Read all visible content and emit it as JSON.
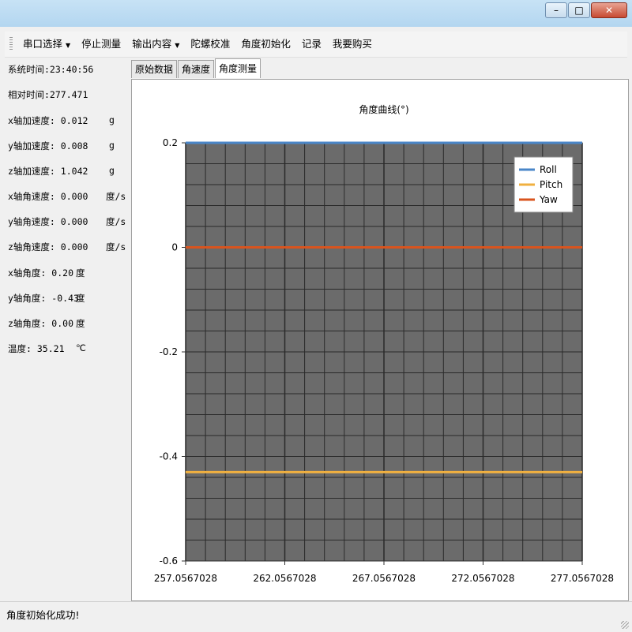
{
  "menu": {
    "items": [
      {
        "label": "串口选择",
        "dropdown": true
      },
      {
        "label": "停止测量",
        "dropdown": false
      },
      {
        "label": "输出内容",
        "dropdown": true
      },
      {
        "label": "陀螺校准",
        "dropdown": false
      },
      {
        "label": "角度初始化",
        "dropdown": false
      },
      {
        "label": "记录",
        "dropdown": false
      },
      {
        "label": "我要购买",
        "dropdown": false
      }
    ]
  },
  "window_buttons": {
    "minimize": "–",
    "maximize": "□",
    "close": "✕"
  },
  "info": {
    "system_time": "系统时间:23:40:56",
    "relative_time": "相对时间:277.471",
    "rows": [
      {
        "label": "x轴加速度:",
        "value": "0.012",
        "unit": "g"
      },
      {
        "label": "y轴加速度:",
        "value": "0.008",
        "unit": "g"
      },
      {
        "label": "z轴加速度:",
        "value": "1.042",
        "unit": "g"
      },
      {
        "label": "x轴角速度:",
        "value": "0.000",
        "unit": "度/s"
      },
      {
        "label": "y轴角速度:",
        "value": "0.000",
        "unit": "度/s"
      },
      {
        "label": "z轴角速度:",
        "value": "0.000",
        "unit": "度/s"
      },
      {
        "label": "x轴角度:",
        "value": "0.20",
        "unit": "度"
      },
      {
        "label": "y轴角度:",
        "value": "-0.43",
        "unit": "度"
      },
      {
        "label": "z轴角度:",
        "value": "0.00",
        "unit": "度"
      },
      {
        "label": "温度:",
        "value": "35.21",
        "unit": "℃"
      }
    ]
  },
  "tabs": [
    "原始数据",
    "角速度",
    "角度测量"
  ],
  "active_tab": 2,
  "status": {
    "text": "角度初始化成功!"
  },
  "colors": {
    "roll": "#4a86c8",
    "pitch": "#f0b040",
    "yaw": "#d9541e",
    "plot_bg": "#6b6b6b"
  },
  "chart_data": {
    "type": "line",
    "title": "角度曲线(°)",
    "x_ticks": [
      "257.0567028",
      "262.0567028",
      "267.0567028",
      "272.0567028",
      "277.0567028"
    ],
    "xlim": [
      257.0567028,
      277.0567028
    ],
    "ylim": [
      -0.6,
      0.2
    ],
    "y_ticks": [
      "0.2",
      "0",
      "-0.2",
      "-0.4",
      "-0.6"
    ],
    "legend_position": "top-right",
    "grid": true,
    "series": [
      {
        "name": "Roll",
        "x": [
          257.0567028,
          277.0567028
        ],
        "y": [
          0.2,
          0.2
        ]
      },
      {
        "name": "Pitch",
        "x": [
          257.0567028,
          277.0567028
        ],
        "y": [
          -0.43,
          -0.43
        ]
      },
      {
        "name": "Yaw",
        "x": [
          257.0567028,
          277.0567028
        ],
        "y": [
          0.0,
          0.0
        ]
      }
    ]
  }
}
